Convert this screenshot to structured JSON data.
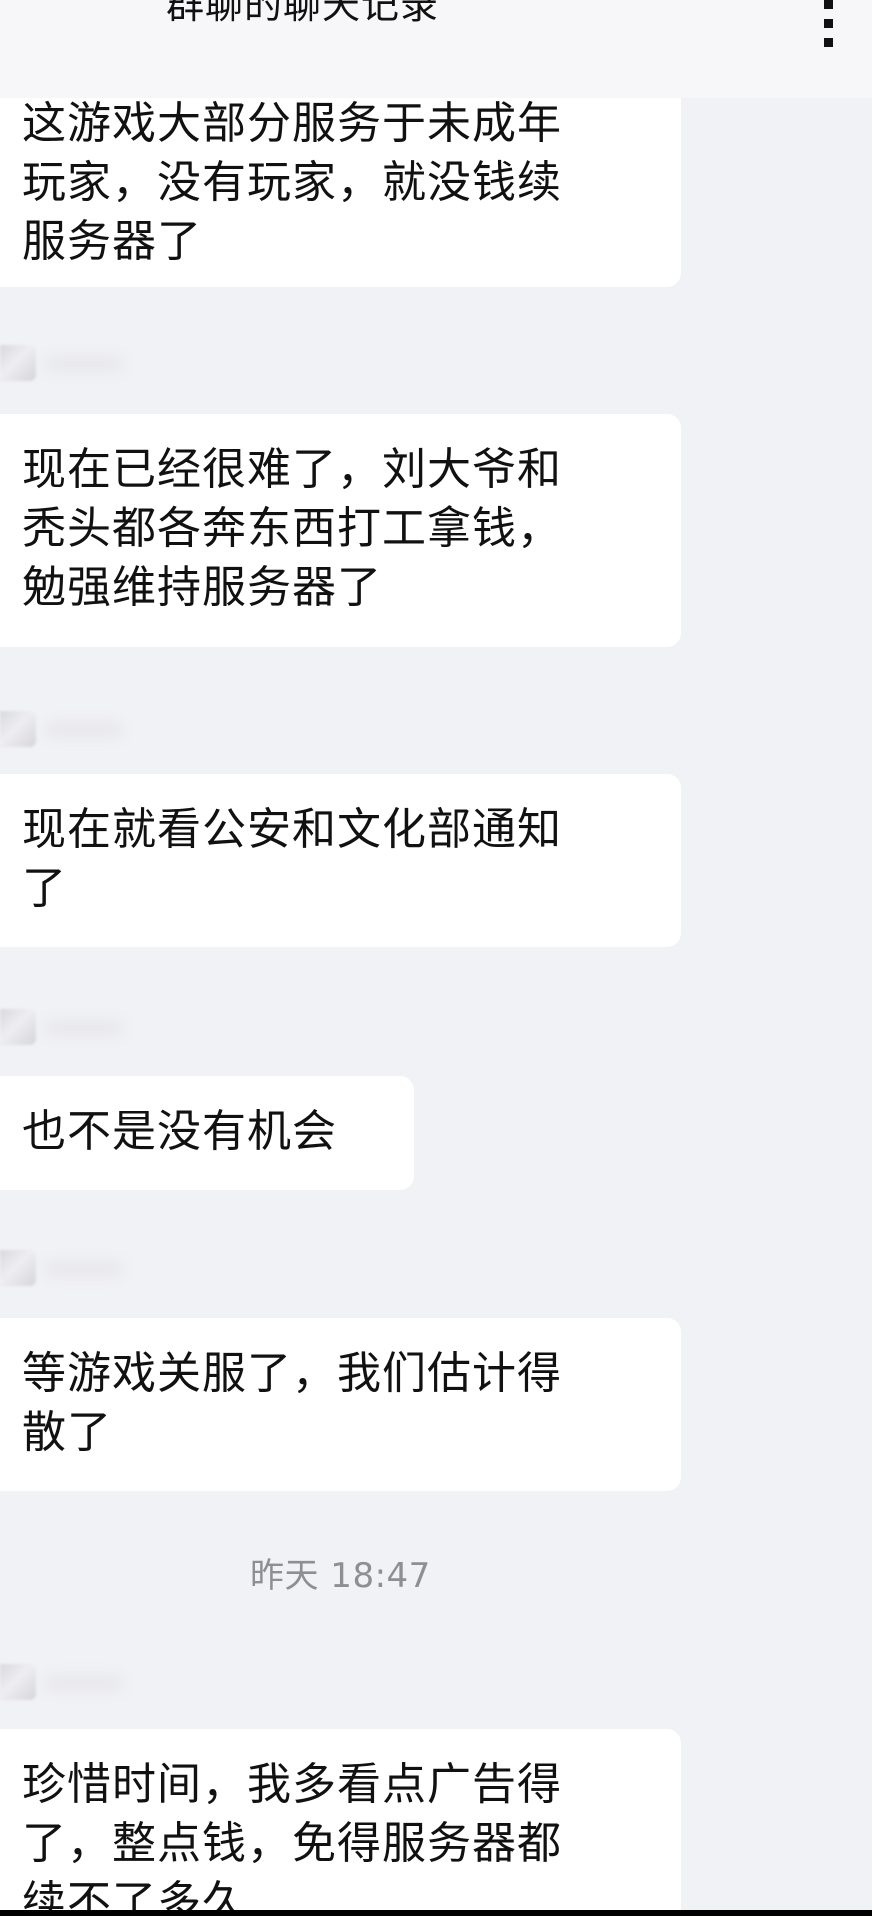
{
  "header": {
    "title": "群聊的聊天记录",
    "more_icon": "more-vertical-icon"
  },
  "messages": [
    {
      "lines": [
        "这游戏大部分服务于未成年",
        "玩家，没有玩家，就没钱续",
        "服务器了"
      ]
    },
    {
      "lines": [
        "现在已经很难了，刘大爷和",
        "秃头都各奔东西打工拿钱，",
        "勉强维持服务器了"
      ]
    },
    {
      "lines": [
        "现在就看公安和文化部通知",
        "了"
      ]
    },
    {
      "lines": [
        "也不是没有机会"
      ]
    },
    {
      "lines": [
        "等游戏关服了，我们估计得",
        "散了"
      ]
    },
    {
      "lines": [
        "珍惜时间，我多看点广告得",
        "了，整点钱，免得服务器都",
        "续不了多久"
      ]
    }
  ],
  "timestamp": "昨天 18:47",
  "colors": {
    "background": "#f1f2f6",
    "bubble": "#ffffff",
    "text": "#111111",
    "timestamp": "#8e8e93"
  }
}
